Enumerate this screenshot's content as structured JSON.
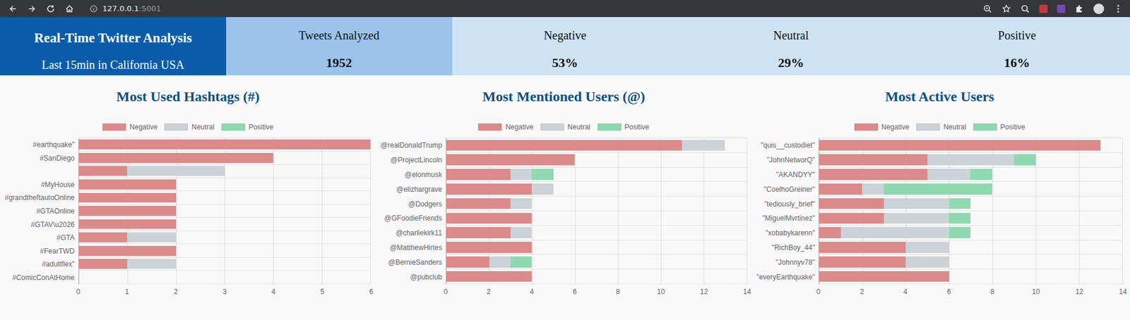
{
  "browser": {
    "url_host": "127.0.0.1",
    "url_port": ":5001"
  },
  "header": {
    "title": "Real-Time Twitter Analysis",
    "subtitle": "Last 15min in California USA",
    "stats": [
      {
        "label": "Tweets Analyzed",
        "value": "1952"
      },
      {
        "label": "Negative",
        "value": "53%"
      },
      {
        "label": "Neutral",
        "value": "29%"
      },
      {
        "label": "Positive",
        "value": "16%"
      }
    ]
  },
  "charts": [
    {
      "title": "Most Used Hashtags (#)",
      "categories": [
        "#earthquake\"",
        "#SanDiego",
        "",
        "#MyHouse",
        "#grandtheftautoOnline",
        "#GTAOnline",
        "#GTAV\\u2026",
        "#GTA",
        "#FearTWD",
        "#adultflex\"",
        "#ComicConAtHome"
      ],
      "ticks": [
        "0",
        "1",
        "2",
        "3",
        "4",
        "5",
        "6"
      ],
      "series": [
        {
          "name": "Negative",
          "color": "#dd8a8a",
          "values": [
            6,
            4,
            1,
            2,
            2,
            2,
            2,
            1,
            2,
            1,
            0
          ]
        },
        {
          "name": "Neutral",
          "color": "#cbd2d8",
          "values": [
            0,
            0,
            2,
            0,
            0,
            0,
            0,
            1,
            0,
            1,
            0
          ]
        },
        {
          "name": "Positive",
          "color": "#8ed9b0",
          "values": [
            0,
            0,
            0,
            0,
            0,
            0,
            0,
            0,
            0,
            0,
            0
          ]
        }
      ]
    },
    {
      "title": "Most Mentioned Users (@)",
      "categories": [
        "@realDonaldTrump",
        "@ProjectLincoln",
        "@elonmusk",
        "@elizhargrave",
        "@Dodgers",
        "@GFoodieFriends",
        "@charliekirk11",
        "@MatthewHirtes",
        "@BernieSanders",
        "@pubclub"
      ],
      "ticks": [
        "0",
        "2",
        "4",
        "6",
        "8",
        "10",
        "12",
        "14"
      ],
      "series": [
        {
          "name": "Negative",
          "color": "#dd8a8a",
          "values": [
            11,
            6,
            3,
            4,
            3,
            4,
            3,
            4,
            2,
            4
          ]
        },
        {
          "name": "Neutral",
          "color": "#cbd2d8",
          "values": [
            2,
            0,
            1,
            1,
            1,
            0,
            1,
            0,
            1,
            0
          ]
        },
        {
          "name": "Positive",
          "color": "#8ed9b0",
          "values": [
            0,
            0,
            1,
            0,
            0,
            0,
            0,
            0,
            1,
            0
          ]
        }
      ]
    },
    {
      "title": "Most Active Users",
      "categories": [
        "\"quis__custodiet\"",
        "\"JohnNetworQ\"",
        "\"AKANDYY\"",
        "\"CoelhoGreiner\"",
        "\"tediously_brief\"",
        "\"MiguelMvrtinez\"",
        "\"xobabykarenn\"",
        "\"RichBoy_44\"",
        "\"Johnnyv78\"",
        "\"everyEarthquake\""
      ],
      "ticks": [
        "0",
        "2",
        "4",
        "6",
        "8",
        "10",
        "12",
        "14"
      ],
      "series": [
        {
          "name": "Negative",
          "color": "#dd8a8a",
          "values": [
            13,
            5,
            5,
            2,
            3,
            3,
            1,
            4,
            4,
            6
          ]
        },
        {
          "name": "Neutral",
          "color": "#cbd2d8",
          "values": [
            0,
            4,
            2,
            1,
            3,
            3,
            5,
            2,
            2,
            0
          ]
        },
        {
          "name": "Positive",
          "color": "#8ed9b0",
          "values": [
            0,
            1,
            1,
            5,
            1,
            1,
            1,
            0,
            0,
            0
          ]
        }
      ]
    }
  ]
}
